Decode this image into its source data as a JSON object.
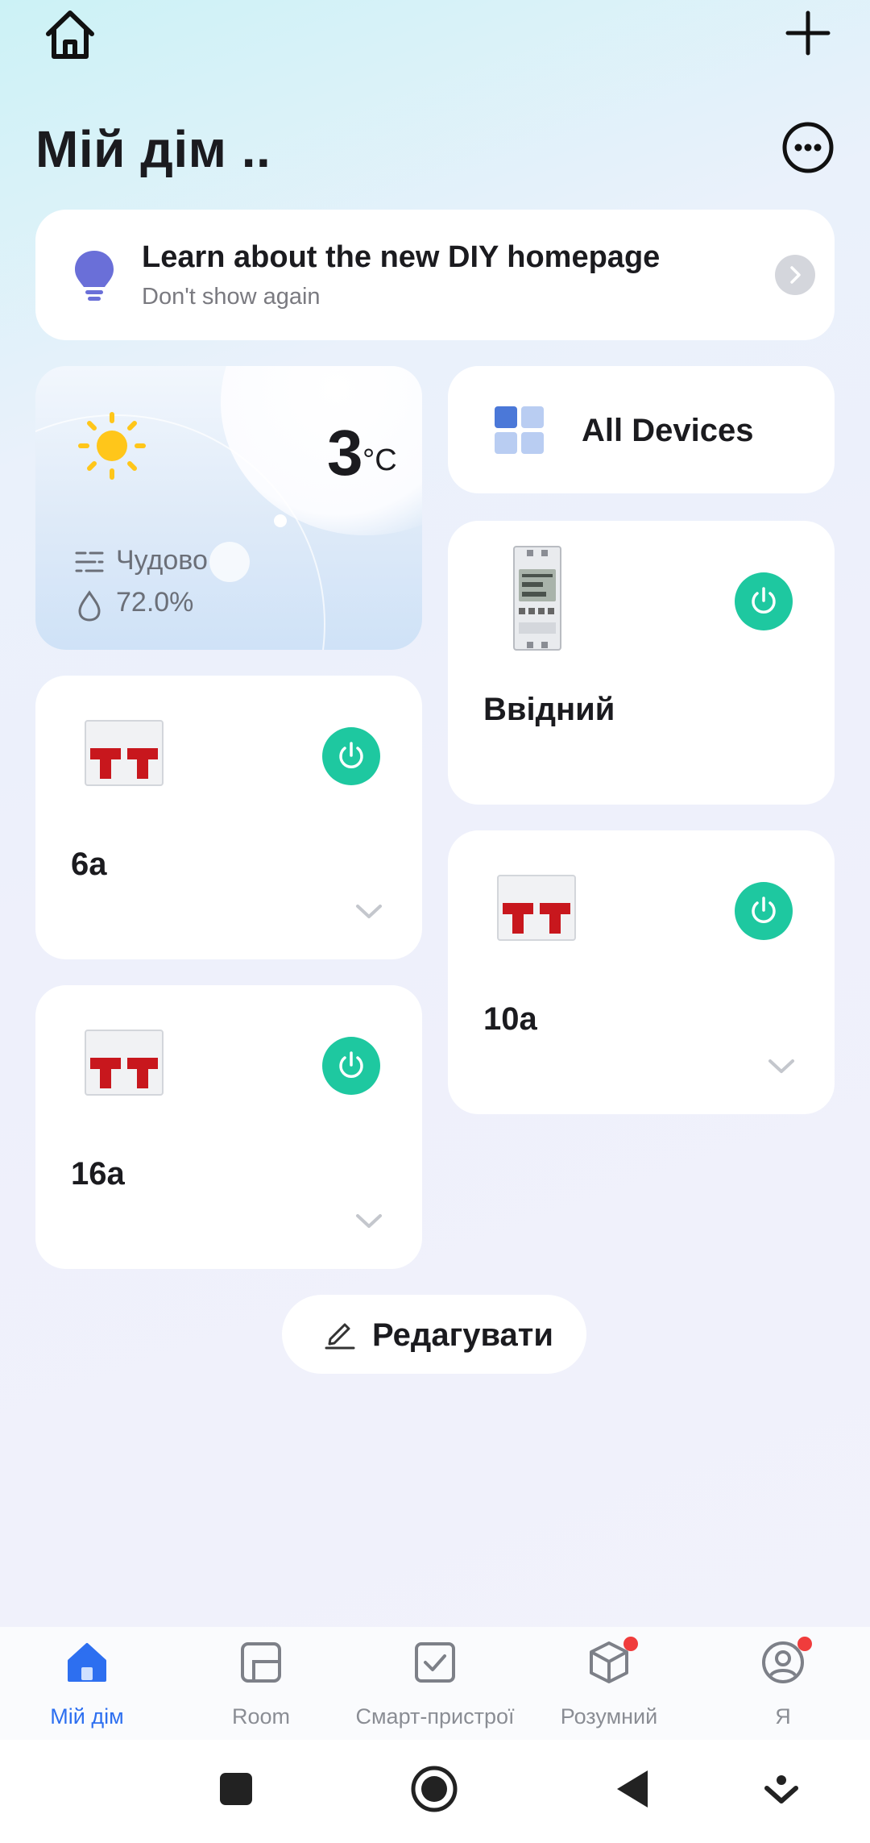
{
  "header": {
    "title": "Мій дім .."
  },
  "banner": {
    "title": "Learn about the new DIY homepage",
    "subtitle": "Don't show again"
  },
  "weather": {
    "temperature": "3",
    "unit": "°C",
    "condition": "Чудово",
    "humidity": "72.0%"
  },
  "all_devices": {
    "label": "All Devices"
  },
  "devices": [
    {
      "name": "Ввідний",
      "state": "on",
      "icon": "energy-meter-icon",
      "has_dropdown": false
    },
    {
      "name": "6а",
      "state": "on",
      "icon": "circuit-breaker-icon",
      "has_dropdown": true
    },
    {
      "name": "10а",
      "state": "on",
      "icon": "circuit-breaker-icon",
      "has_dropdown": true
    },
    {
      "name": "16а",
      "state": "on",
      "icon": "circuit-breaker-icon",
      "has_dropdown": true
    }
  ],
  "edit_button": {
    "label": "Редагувати"
  },
  "tabs": [
    {
      "label": "Мій дім",
      "icon": "home-icon",
      "active": true,
      "badge": false
    },
    {
      "label": "Room",
      "icon": "room-icon",
      "active": false,
      "badge": false
    },
    {
      "label": "Смарт-пристрої",
      "icon": "checkbox-icon",
      "active": false,
      "badge": false
    },
    {
      "label": "Розумний",
      "icon": "cube-icon",
      "active": false,
      "badge": true
    },
    {
      "label": "Я",
      "icon": "profile-icon",
      "active": false,
      "badge": true
    }
  ],
  "colors": {
    "accent": "#2d6ff0",
    "power_on": "#1ec8a0",
    "badge": "#f03c3c",
    "bulb": "#6a6fd8"
  }
}
